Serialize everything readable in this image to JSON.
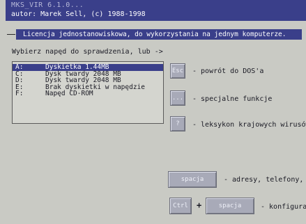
{
  "header": {
    "line1": "MKS_VIR 6.1.0...",
    "line2": "autor: Marek Sell, (c) 1988-1998"
  },
  "license": "Licencja jednostanowiskowa, do wykorzystania na jednym komputerze.",
  "prompt": "Wybierz napęd do sprawdzenia, lub ->",
  "drives": [
    {
      "letter": "A:",
      "label": "Dyskietka 1.44MB"
    },
    {
      "letter": "C:",
      "label": "Dysk twardy 2048 MB"
    },
    {
      "letter": "D:",
      "label": "Dysk twardy 2048 MB"
    },
    {
      "letter": "E:",
      "label": "Brak dyskietki w napędzie"
    },
    {
      "letter": "F:",
      "label": "Napęd CD-ROM"
    }
  ],
  "actions": {
    "esc": {
      "key": "Esc",
      "desc": "- powrót do DOS'a"
    },
    "fn": {
      "key": "...",
      "desc": "- specjalne funkcje"
    },
    "help": {
      "key": "?",
      "desc": "- leksykon krajowych wirusów"
    },
    "space": {
      "key": "spacja",
      "desc": "- adresy, telefony,"
    },
    "ctrl_space": {
      "key1": "Ctrl",
      "plus": "+",
      "key2": "spacja",
      "desc": "- konfigurac"
    }
  }
}
